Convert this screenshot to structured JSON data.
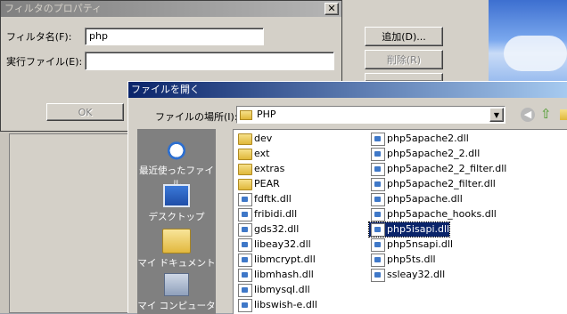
{
  "filter_dialog": {
    "title": "フィルタのプロパティ",
    "close_glyph": "✕",
    "name_label": "フィルタ名(F):",
    "name_value": "php",
    "exe_label": "実行ファイル(E):",
    "exe_value": "",
    "ok_label": "OK"
  },
  "background_app": {
    "add_button": "追加(D)...",
    "remove_button": "削除(R)"
  },
  "open_dialog": {
    "title": "ファイルを開く",
    "location_label": "ファイルの場所(I):",
    "location_value": "PHP",
    "places": [
      {
        "label": "最近使ったファイル",
        "icon": "recent-icon"
      },
      {
        "label": "デスクトップ",
        "icon": "desktop-icon"
      },
      {
        "label": "マイ ドキュメント",
        "icon": "my-documents-icon"
      },
      {
        "label": "マイ コンピュータ",
        "icon": "my-computer-icon"
      }
    ],
    "files_col1": [
      {
        "name": "dev",
        "type": "folder"
      },
      {
        "name": "ext",
        "type": "folder"
      },
      {
        "name": "extras",
        "type": "folder"
      },
      {
        "name": "PEAR",
        "type": "folder"
      },
      {
        "name": "fdftk.dll",
        "type": "dll"
      },
      {
        "name": "fribidi.dll",
        "type": "dll"
      },
      {
        "name": "gds32.dll",
        "type": "dll"
      },
      {
        "name": "libeay32.dll",
        "type": "dll"
      },
      {
        "name": "libmcrypt.dll",
        "type": "dll"
      },
      {
        "name": "libmhash.dll",
        "type": "dll"
      },
      {
        "name": "libmysql.dll",
        "type": "dll"
      },
      {
        "name": "libswish-e.dll",
        "type": "dll"
      }
    ],
    "files_col2": [
      {
        "name": "php5apache2.dll",
        "type": "dll"
      },
      {
        "name": "php5apache2_2.dll",
        "type": "dll"
      },
      {
        "name": "php5apache2_2_filter.dll",
        "type": "dll"
      },
      {
        "name": "php5apache2_filter.dll",
        "type": "dll"
      },
      {
        "name": "php5apache.dll",
        "type": "dll"
      },
      {
        "name": "php5apache_hooks.dll",
        "type": "dll"
      },
      {
        "name": "php5isapi.dll",
        "type": "dll",
        "selected": true
      },
      {
        "name": "php5nsapi.dll",
        "type": "dll"
      },
      {
        "name": "php5ts.dll",
        "type": "dll"
      },
      {
        "name": "ssleay32.dll",
        "type": "dll"
      }
    ]
  }
}
